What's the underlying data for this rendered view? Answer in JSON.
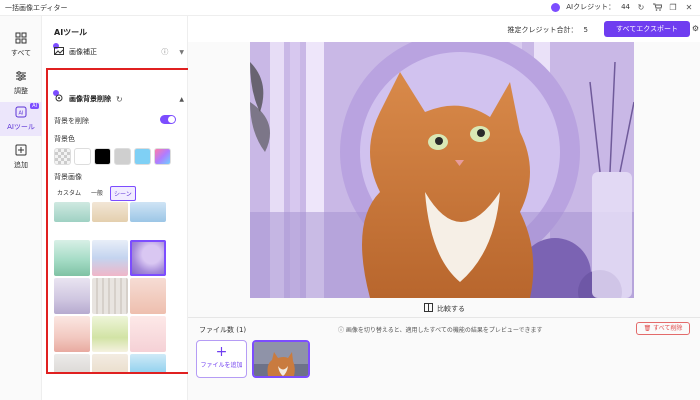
{
  "window": {
    "title": "一括画像エディター",
    "credits_label": "AIクレジット：",
    "credits_value": "44"
  },
  "rail": [
    {
      "key": "all",
      "label": "すべて"
    },
    {
      "key": "adjust",
      "label": "調整"
    },
    {
      "key": "ai",
      "label": "AIツール",
      "badge": "AI"
    },
    {
      "key": "add",
      "label": "追加"
    }
  ],
  "panel": {
    "title": "AIツール",
    "enhance_label": "画像補正",
    "bg_remove": {
      "label": "画像背景削除",
      "remove_bg_label": "背景を削除",
      "remove_bg_on": true,
      "bg_color_label": "背景色",
      "swatches": [
        "transparent",
        "#ffffff",
        "#000000",
        "#cfcfcf",
        "#7fd0f5",
        "gradient"
      ],
      "bg_image_label": "背景画像",
      "tabs": [
        {
          "label": "カスタム",
          "active": false
        },
        {
          "label": "一般",
          "active": false
        },
        {
          "label": "シーン",
          "active": true
        }
      ]
    }
  },
  "main": {
    "est_label": "推定クレジット合計：",
    "est_value": "5",
    "export_label": "すべてエクスポート",
    "compare_label": "比較する",
    "file_count_label": "ファイル数 (1)",
    "hint": "画像を切り替えると、適用したすべての機能の結果をプレビューできます",
    "delete_all_label": "すべて削除",
    "add_file_label": "ファイルを追加"
  },
  "colors": {
    "accent": "#6f3df0",
    "highlight": "#e02020",
    "danger": "#e04848"
  }
}
